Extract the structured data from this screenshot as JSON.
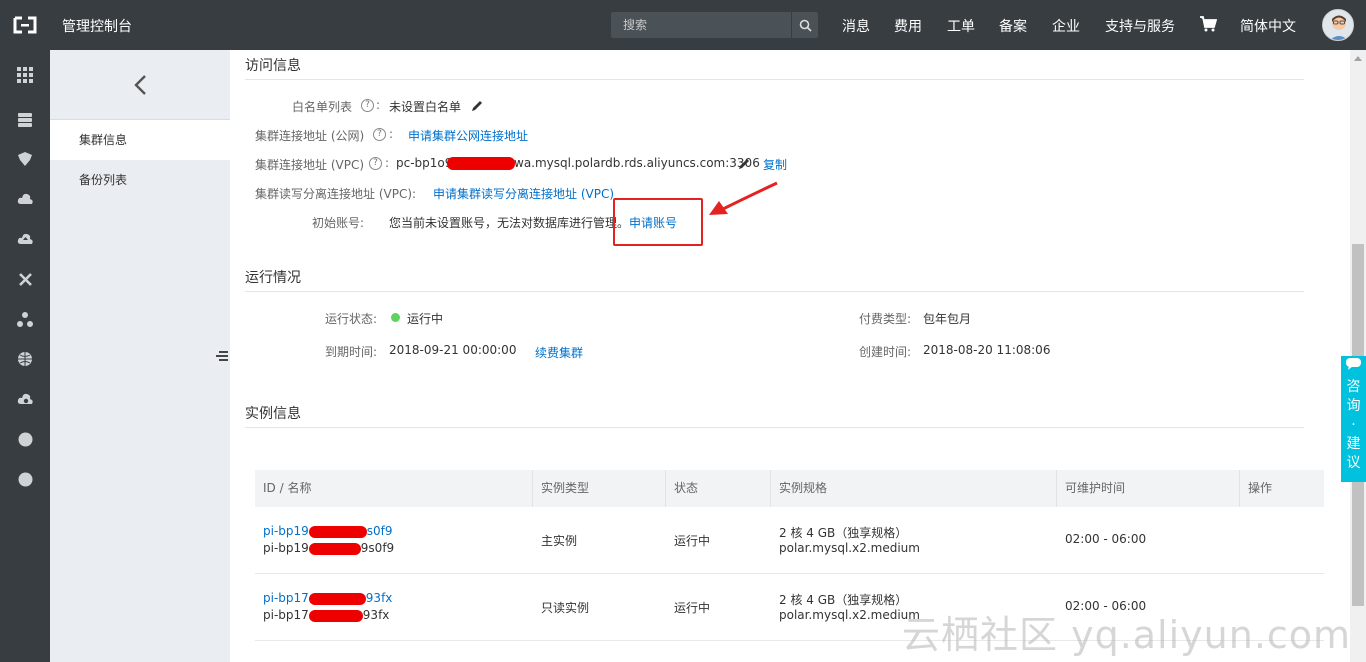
{
  "topbar": {
    "title": "管理控制台",
    "search_placeholder": "搜索",
    "nav": [
      "消息",
      "费用",
      "工单",
      "备案",
      "企业",
      "支持与服务"
    ],
    "language": "简体中文"
  },
  "subnav": {
    "items": [
      {
        "label": "集群信息",
        "active": true
      },
      {
        "label": "备份列表",
        "active": false
      }
    ]
  },
  "access": {
    "title": "访问信息",
    "whitelist_label": "白名单列表",
    "whitelist_value": "未设置白名单",
    "public_label": "集群连接地址 (公网)",
    "public_link": "申请集群公网连接地址",
    "vpc_label": "集群连接地址 (VPC)",
    "vpc_value_prefix": "pc-bp1o9",
    "vpc_value_suffix": "wa.mysql.polardb.rds.aliyuncs.com:3306",
    "copy_link": "复制",
    "rw_label": "集群读写分离连接地址 (VPC):",
    "rw_link": "申请集群读写分离连接地址 (VPC)",
    "account_label": "初始账号:",
    "account_text": "您当前未设置账号，无法对数据库进行管理。",
    "account_link": "申请账号"
  },
  "running": {
    "title": "运行情况",
    "status_label": "运行状态:",
    "status_value": "运行中",
    "expire_label": "到期时间:",
    "expire_value": "2018-09-21 00:00:00",
    "renew_link": "续费集群",
    "pay_label": "付费类型:",
    "pay_value": "包年包月",
    "created_label": "创建时间:",
    "created_value": "2018-08-20 11:08:06"
  },
  "instances": {
    "title": "实例信息",
    "columns": [
      "ID / 名称",
      "实例类型",
      "状态",
      "实例规格",
      "可维护时间",
      "操作"
    ],
    "rows": [
      {
        "id_prefix": "pi-bp19",
        "id_suffix": "s0f9",
        "name_prefix": "pi-bp19",
        "name_suffix": "9s0f9",
        "type": "主实例",
        "status": "运行中",
        "spec": "2 核 4 GB（独享规格）",
        "spec_code": "polar.mysql.x2.medium",
        "window": "02:00 - 06:00"
      },
      {
        "id_prefix": "pi-bp17",
        "id_suffix": "93fx",
        "name_prefix": "pi-bp17",
        "name_suffix": "93fx",
        "type": "只读实例",
        "status": "运行中",
        "spec": "2 核 4 GB（独享规格）",
        "spec_code": "polar.mysql.x2.medium",
        "window": "02:00 - 06:00"
      }
    ]
  },
  "feedback": {
    "label": "咨询·建议"
  },
  "watermark": "云栖社区 yq.aliyun.com",
  "colors": {
    "topbar": "#373d41",
    "link": "#0070cc",
    "accent": "#00c1de",
    "highlight": "#e52222"
  }
}
